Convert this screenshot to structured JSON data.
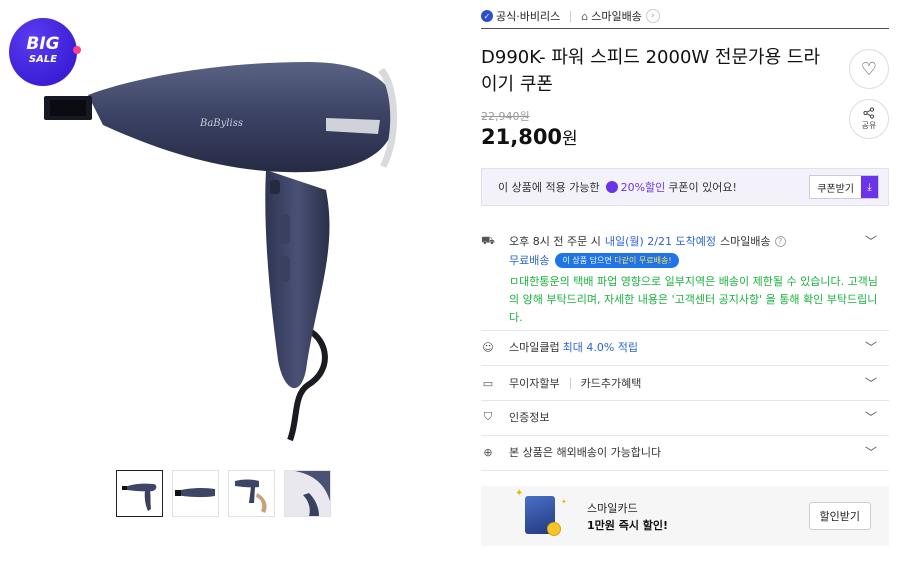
{
  "badge": {
    "line1": "BIG",
    "line2": "SALE"
  },
  "seller": {
    "brand": "공식·바비리스",
    "delivery": "스마일배송"
  },
  "product": {
    "title": "D990K- 파워 스피드 2000W 전문가용 드라이기 쿠폰",
    "price_original": "22,940원",
    "price_now": "21,800",
    "price_unit": "원",
    "share_label": "공유"
  },
  "coupon": {
    "text_before": "이 상품에 적용 가능한",
    "percent": "20%할인",
    "text_after": "쿠폰이 있어요!",
    "button": "쿠폰받기"
  },
  "shipping": {
    "line_prefix": "오후 8시 전 주문 시",
    "eta": "내일(월) 2/21 도착예정",
    "type": "스마일배송",
    "free": "무료배송",
    "promo_prefix": "이 상품 담으면",
    "promo_highlight": "다같이 무료배송!",
    "notice": "ㅁ대한통운의 택배 파업 영향으로 일부지역은 배송이 제한될 수 있습니다. 고객님의 양해 부탁드리며, 자세한 내용은 '고객센터 공지사항' 을 통해 확인 부탁드립니다."
  },
  "smile_club": {
    "label": "스마일클럽",
    "value": "최대 4.0% 적립"
  },
  "installment": {
    "label": "무이자할부",
    "extra": "카드추가혜택"
  },
  "certification": {
    "label": "인증정보"
  },
  "global": {
    "label": "본 상품은 해외배송이 가능합니다"
  },
  "card_banner": {
    "line1": "스마일카드",
    "line2": "1만원 즉시 할인!",
    "button": "할인받기"
  },
  "colors": {
    "accent_purple": "#6a34e8",
    "link_blue": "#2a64d6",
    "notice_green": "#19b23d",
    "pill_blue": "#1f74e8"
  },
  "icons": [
    "verified-shield-icon",
    "home-icon",
    "heart-icon",
    "share-icon",
    "truck-icon",
    "smile-club-icon",
    "card-icon",
    "certification-shield-icon",
    "globe-icon",
    "chevron-down-icon",
    "download-icon"
  ]
}
